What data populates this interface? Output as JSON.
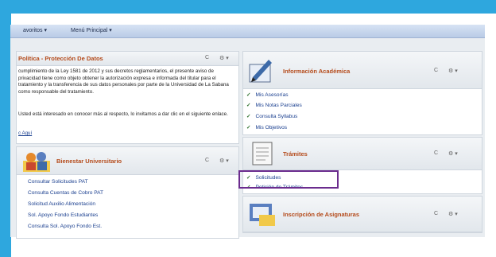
{
  "menubar": {
    "favorites": "avoritos ▾",
    "main_menu": "Menú Principal ▾"
  },
  "panel_policy": {
    "title": "Política - Protección De Datos",
    "refresh": "C",
    "settings": "⚙ ▾",
    "para1": "cumplimiento de la Ley 1581 de 2012 y sus decretos reglamentarios, el presente aviso de privacidad tiene como objeto obtener la autorización expresa e informada del titular para el tratamiento y la transferencia de sus datos personales por parte de la Universidad de La Sabana como responsable del tratamiento.",
    "para2": "Usted está interesado en conocer más al respecto, lo invitamos a dar clic en el siguiente enlace.",
    "link": "c Aquí"
  },
  "panel_bienestar": {
    "title": "Bienestar Universitario",
    "refresh": "C",
    "settings": "⚙ ▾",
    "links": [
      "Consultar Solicitudes PAT",
      "Consulta Cuentas de Cobro PAT",
      "Solicitud Auxilio Alimentación",
      "Sol. Apoyo Fondo Estudiantes",
      "Consulta Sol. Apoyo Fondo Est."
    ]
  },
  "panel_academica": {
    "title": "Información Académica",
    "refresh": "C",
    "settings": "⚙ ▾",
    "links": [
      "Mis Asesorías",
      "Mis Notas Parciales",
      "Consulta Syllabus",
      "Mis Objetivos"
    ]
  },
  "panel_tramites": {
    "title": "Trámites",
    "refresh": "C",
    "settings": "⚙ ▾",
    "links": [
      "Solicitudes",
      "Petición de Trámites"
    ]
  },
  "panel_inscripcion": {
    "title": "Inscripción de Asignaturas",
    "refresh": "C",
    "settings": "⚙ ▾"
  },
  "colors": {
    "frame_bg": "#2ea7de",
    "title": "#b44a1a",
    "link": "#1a3f8f",
    "highlight": "#6b2c8e"
  }
}
